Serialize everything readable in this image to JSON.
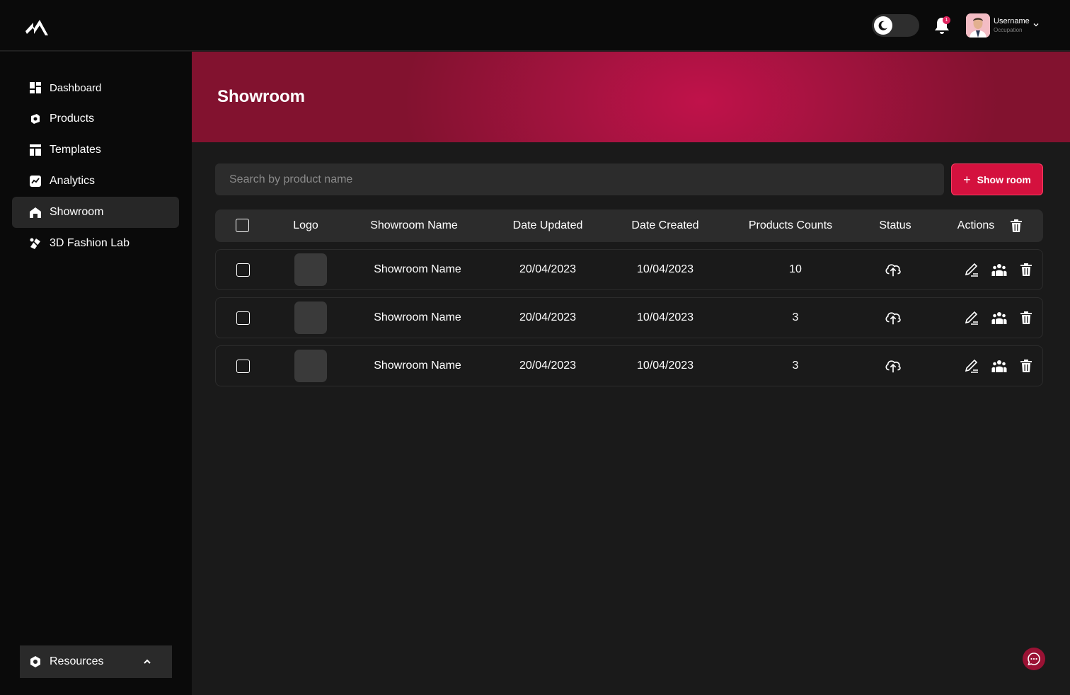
{
  "header": {
    "user_name": "Username",
    "user_occupation": "Occupation",
    "notification_count": "1",
    "theme": "dark"
  },
  "sidebar": {
    "items": [
      {
        "label": "Dashboard",
        "icon": "dashboard-icon"
      },
      {
        "label": "Products",
        "icon": "products-icon"
      },
      {
        "label": "Templates",
        "icon": "templates-icon"
      },
      {
        "label": "Analytics",
        "icon": "analytics-icon"
      },
      {
        "label": "Showroom",
        "icon": "showroom-icon",
        "active": true
      },
      {
        "label": "3D Fashion Lab",
        "icon": "fashion-lab-icon"
      }
    ],
    "resources_label": "Resources"
  },
  "page": {
    "title": "Showroom",
    "search_placeholder": "Search by product name",
    "add_button_label": "Show room"
  },
  "table": {
    "columns": [
      "Logo",
      "Showroom Name",
      "Date Updated",
      "Date Created",
      "Products Counts",
      "Status",
      "Actions"
    ],
    "rows": [
      {
        "name": "Showroom Name",
        "date_updated": "20/04/2023",
        "date_created": "10/04/2023",
        "products_count": "10"
      },
      {
        "name": "Showroom Name",
        "date_updated": "20/04/2023",
        "date_created": "10/04/2023",
        "products_count": "3"
      },
      {
        "name": "Showroom Name",
        "date_updated": "20/04/2023",
        "date_created": "10/04/2023",
        "products_count": "3"
      }
    ]
  },
  "colors": {
    "accent": "#d4113e",
    "banner": "#c0124a",
    "background": "#1a1a1a",
    "sidebar": "#0a0a0a"
  }
}
